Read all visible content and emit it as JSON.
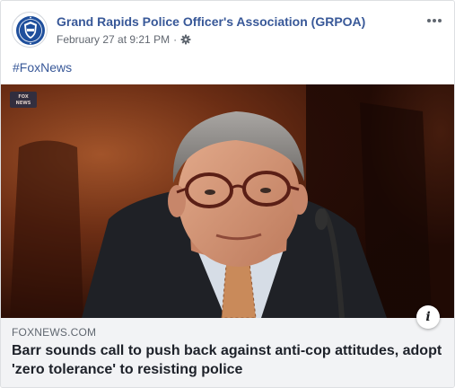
{
  "post": {
    "page_name": "Grand Rapids Police Officer's Association (GRPOA)",
    "timestamp": "February 27 at 9:21 PM",
    "separator": "·",
    "audience_icon": "gear-icon",
    "more_icon": "more-options-icon",
    "text": "#FoxNews"
  },
  "link": {
    "domain": "FOXNEWS.COM",
    "title": "Barr sounds call to push back against anti-cop attitudes, adopt 'zero tolerance' to resisting police",
    "info_label": "i"
  },
  "colors": {
    "link_blue": "#385898",
    "meta_gray": "#616770",
    "card_bg": "#f2f3f5",
    "title_text": "#1d2129"
  }
}
